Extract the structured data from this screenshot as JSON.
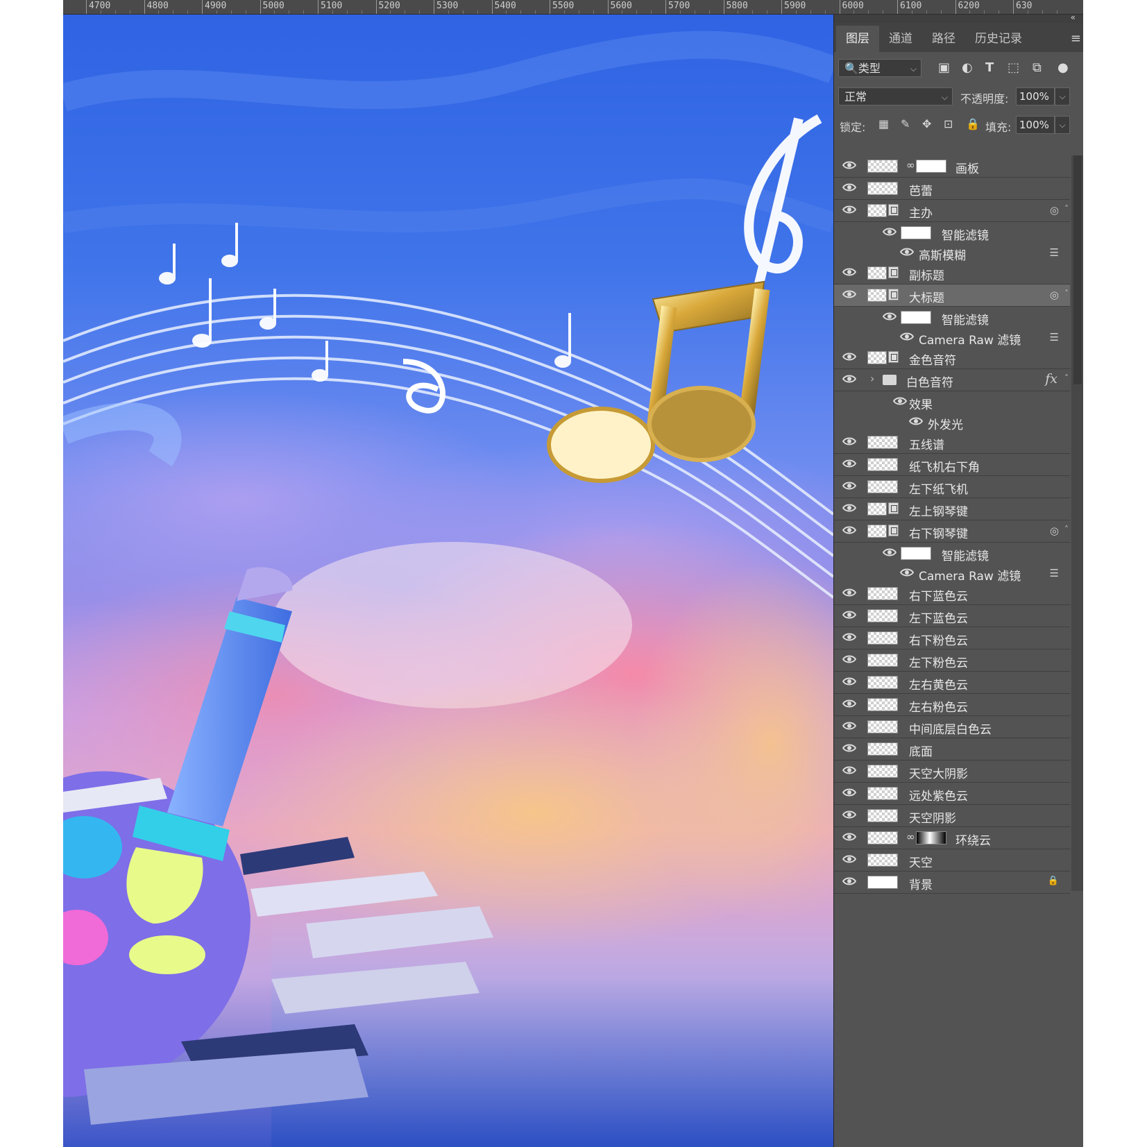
{
  "ruler": {
    "ticks": [
      "4700",
      "4800",
      "4900",
      "5000",
      "5100",
      "5200",
      "5300",
      "5400",
      "5500",
      "5600",
      "5700",
      "5800",
      "5900",
      "6000",
      "6100",
      "6200",
      "630"
    ]
  },
  "panel": {
    "tabs": [
      "图层",
      "通道",
      "路径",
      "历史记录"
    ],
    "filter": {
      "label": "类型"
    },
    "blend_mode": "正常",
    "opacity_label": "不透明度:",
    "opacity": "100%",
    "lock_label": "锁定:",
    "fill_label": "填充:",
    "fill": "100%",
    "layers": [
      {
        "name": "画板",
        "kind": "mask"
      },
      {
        "name": "芭蕾",
        "kind": "plain"
      },
      {
        "name": "主办",
        "kind": "smart",
        "has_filters": true
      },
      {
        "name": "智能滤镜",
        "kind": "filter-head"
      },
      {
        "name": "高斯模糊",
        "kind": "filter"
      },
      {
        "name": "副标题",
        "kind": "smart"
      },
      {
        "name": "大标题",
        "kind": "smart",
        "has_filters": true,
        "selected": true
      },
      {
        "name": "智能滤镜",
        "kind": "filter-head"
      },
      {
        "name": "Camera Raw 滤镜",
        "kind": "filter"
      },
      {
        "name": "金色音符",
        "kind": "smart"
      },
      {
        "name": "白色音符",
        "kind": "group",
        "fx": "fx"
      },
      {
        "name": "效果",
        "kind": "effect-head"
      },
      {
        "name": "外发光",
        "kind": "effect"
      },
      {
        "name": "五线谱",
        "kind": "plain"
      },
      {
        "name": "纸飞机右下角",
        "kind": "plain"
      },
      {
        "name": "左下纸飞机",
        "kind": "plain"
      },
      {
        "name": "左上钢琴键",
        "kind": "smart"
      },
      {
        "name": "右下钢琴键",
        "kind": "smart",
        "has_filters": true
      },
      {
        "name": "智能滤镜",
        "kind": "filter-head"
      },
      {
        "name": "Camera Raw 滤镜",
        "kind": "filter"
      },
      {
        "name": "右下蓝色云",
        "kind": "plain"
      },
      {
        "name": "左下蓝色云",
        "kind": "plain"
      },
      {
        "name": "右下粉色云",
        "kind": "plain"
      },
      {
        "name": "左下粉色云",
        "kind": "plain"
      },
      {
        "name": "左右黄色云",
        "kind": "plain"
      },
      {
        "name": "左右粉色云",
        "kind": "plain"
      },
      {
        "name": "中间底层白色云",
        "kind": "plain"
      },
      {
        "name": "底面",
        "kind": "plain"
      },
      {
        "name": "天空大阴影",
        "kind": "plain"
      },
      {
        "name": "远处紫色云",
        "kind": "plain"
      },
      {
        "name": "天空阴影",
        "kind": "plain"
      },
      {
        "name": "环绕云",
        "kind": "mask-grad"
      },
      {
        "name": "天空",
        "kind": "plain"
      },
      {
        "name": "背景",
        "kind": "background",
        "locked": true
      }
    ]
  }
}
